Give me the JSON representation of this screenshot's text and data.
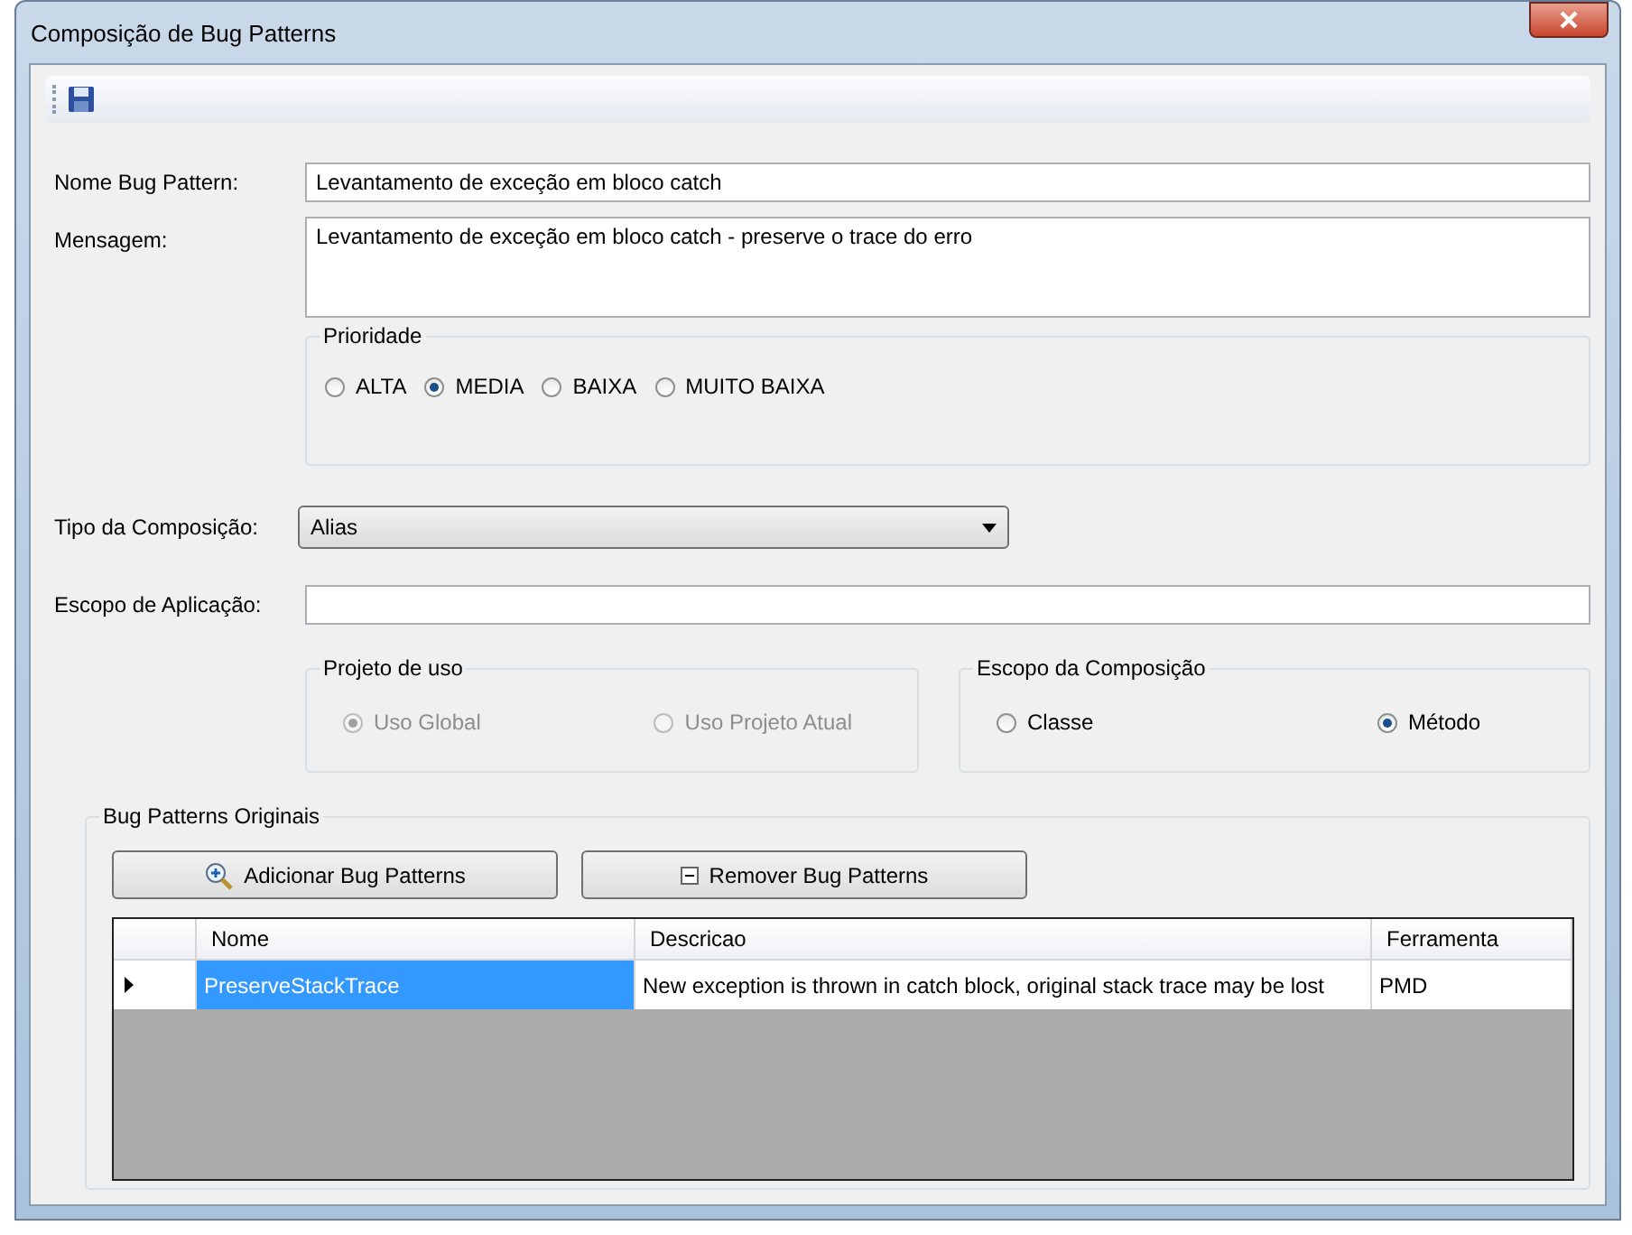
{
  "window": {
    "title": "Composição de Bug Patterns"
  },
  "nome": {
    "label": "Nome Bug Pattern:",
    "value": "Levantamento de exceção em bloco catch"
  },
  "mensagem": {
    "label": "Mensagem:",
    "value": "Levantamento de exceção em bloco catch - preserve o trace do erro"
  },
  "prioridade": {
    "legend": "Prioridade",
    "disabled": false,
    "options": [
      {
        "label": "ALTA",
        "selected": false
      },
      {
        "label": "MEDIA",
        "selected": true
      },
      {
        "label": "BAIXA",
        "selected": false
      },
      {
        "label": "MUITO BAIXA",
        "selected": false
      }
    ]
  },
  "tipo_composicao": {
    "label": "Tipo da Composição:",
    "value": "Alias"
  },
  "escopo_aplicacao": {
    "label": "Escopo de Aplicação:"
  },
  "projeto_de_uso": {
    "legend": "Projeto de uso",
    "disabled": true,
    "options": [
      {
        "label": "Uso Global",
        "selected": true
      },
      {
        "label": "Uso Projeto Atual",
        "selected": false
      }
    ]
  },
  "escopo_composicao": {
    "legend": "Escopo da Composição",
    "disabled": false,
    "options": [
      {
        "label": "Classe",
        "selected": false
      },
      {
        "label": "Método",
        "selected": true
      }
    ]
  },
  "bug_patterns": {
    "legend": "Bug Patterns Originais",
    "buttons": [
      {
        "kind": "add",
        "label": "Adicionar Bug Patterns"
      },
      {
        "kind": "remove",
        "label": "Remover Bug Patterns"
      }
    ],
    "table": {
      "columns": [
        "Nome",
        "Descricao",
        "Ferramenta"
      ],
      "rows": [
        {
          "selected": true,
          "cells": [
            "PreserveStackTrace",
            "New exception is thrown in catch block, original stack trace may be lost",
            "PMD"
          ]
        }
      ]
    }
  }
}
